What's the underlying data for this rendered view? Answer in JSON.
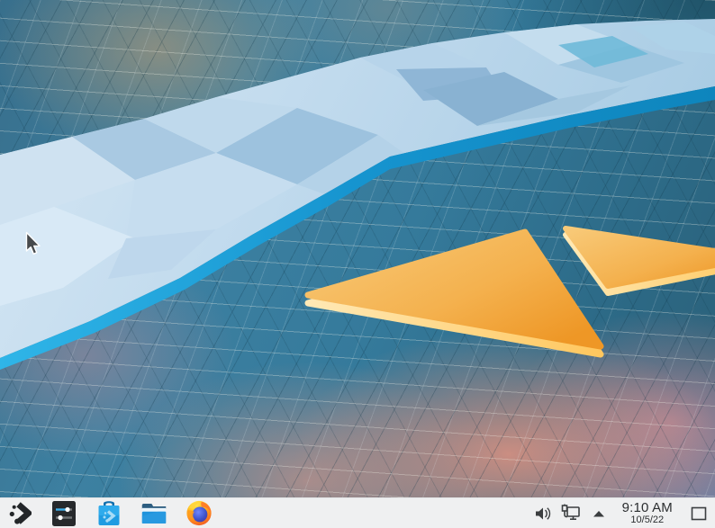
{
  "wallpaper": {
    "style": "low-poly mesh landscape with glacier band and orange deltas",
    "colors": {
      "base_teal": "#3a7ea0",
      "dark_teal": "#2a5f77",
      "glacier_light": "#cfe2f1",
      "glacier_mid": "#9dc2de",
      "edge_cyan": "#1e9cd8",
      "delta_orange_light": "#f8ca79",
      "delta_orange_deep": "#ee9726",
      "blur_tan": "#c69e70",
      "blur_salmon": "#f39781",
      "blur_violet": "#8e96c4"
    },
    "cursor": "arrow-cursor"
  },
  "taskbar": {
    "background": "#eff0f1",
    "apps": [
      {
        "id": "app-launcher",
        "icon": "kde-launcher-icon"
      },
      {
        "id": "system-settings",
        "icon": "settings-sliders-icon"
      },
      {
        "id": "discover",
        "icon": "discover-bag-icon"
      },
      {
        "id": "file-manager",
        "icon": "folder-icon"
      },
      {
        "id": "firefox",
        "icon": "firefox-icon"
      }
    ],
    "tray": [
      {
        "id": "volume",
        "icon": "speaker-icon"
      },
      {
        "id": "network",
        "icon": "network-icon"
      },
      {
        "id": "expand-tray",
        "icon": "chevron-up-icon"
      }
    ],
    "clock": {
      "time": "9:10 AM",
      "date": "10/5/22"
    },
    "show_desktop": {
      "icon": "show-desktop-icon"
    }
  }
}
